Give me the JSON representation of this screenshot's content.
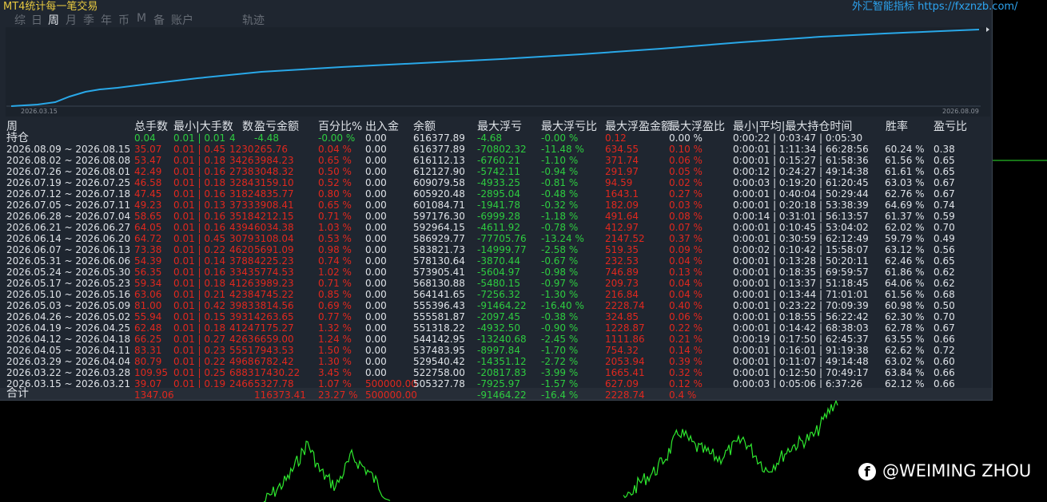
{
  "app_title": "MT4统计每一笔交易",
  "header_link": {
    "prefix": "外汇智能指标",
    "url": "https://fxznzb.com/"
  },
  "tabs": [
    {
      "label": "综"
    },
    {
      "label": "日"
    },
    {
      "label": "周",
      "active": true
    },
    {
      "label": "月"
    },
    {
      "label": "季"
    },
    {
      "label": "年"
    },
    {
      "label": "币"
    },
    {
      "label": "M"
    },
    {
      "label": "备"
    },
    {
      "label": "账户"
    },
    {
      "label": "轨迹"
    }
  ],
  "equity_chart": {
    "start_date": "2026.03.15",
    "end_date": "2026.08.09",
    "line_color": "#29a8e8"
  },
  "columns": [
    "周",
    "总手数",
    "最小|大手数",
    "数",
    "盈亏金额",
    "百分比%",
    "出入金",
    "余额",
    "最大浮亏",
    "最大浮亏比",
    "最大浮盈金额",
    "最大浮盈比",
    "最小|平均|最大持仓时间",
    "胜率",
    "盈亏比"
  ],
  "holding": {
    "label": "持仓",
    "lots": "0.04",
    "minmax": "0.01 | 0.01",
    "count": "4",
    "pnl": "-4.48",
    "pct": "-0.00 %",
    "deposit": "0.00",
    "balance": "616377.89",
    "max_dd": "-4.68",
    "max_dd_pct": "-0.00 %",
    "max_fp": "0.12",
    "max_fp_pct": "0.00 %",
    "hold_time": "0:00:22 | 0:03:47 | 0:05:30"
  },
  "rows": [
    {
      "period": "2026.08.09 ~ 2026.08.15",
      "lots": "35.07",
      "minmax": "0.01 | 0.45",
      "count": "1230",
      "pnl": "265.76",
      "pct": "0.04 %",
      "deposit": "0.00",
      "balance": "616377.89",
      "max_dd": "-70802.32",
      "max_dd_pct": "-11.48 %",
      "max_fp": "634.55",
      "max_fp_pct": "0.10 %",
      "hold_time": "0:00:01 | 1:11:34 | 66:28:56",
      "win_rate": "60.24 %",
      "pl_ratio": "0.38"
    },
    {
      "period": "2026.08.02 ~ 2026.08.08",
      "lots": "53.47",
      "minmax": "0.01 | 0.18",
      "count": "3426",
      "pnl": "3984.23",
      "pct": "0.65 %",
      "deposit": "0.00",
      "balance": "616112.13",
      "max_dd": "-6760.21",
      "max_dd_pct": "-1.10 %",
      "max_fp": "371.74",
      "max_fp_pct": "0.06 %",
      "hold_time": "0:00:01 | 0:15:27 | 61:58:36",
      "win_rate": "61.56 %",
      "pl_ratio": "0.65"
    },
    {
      "period": "2026.07.26 ~ 2026.08.01",
      "lots": "42.49",
      "minmax": "0.01 | 0.16",
      "count": "2738",
      "pnl": "3048.32",
      "pct": "0.50 %",
      "deposit": "0.00",
      "balance": "612127.90",
      "max_dd": "-5742.11",
      "max_dd_pct": "-0.94 %",
      "max_fp": "291.97",
      "max_fp_pct": "0.05 %",
      "hold_time": "0:00:12 | 0:24:27 | 49:14:38",
      "win_rate": "61.61 %",
      "pl_ratio": "0.65"
    },
    {
      "period": "2026.07.19 ~ 2026.07.25",
      "lots": "46.58",
      "minmax": "0.01 | 0.18",
      "count": "3284",
      "pnl": "3159.10",
      "pct": "0.52 %",
      "deposit": "0.00",
      "balance": "609079.58",
      "max_dd": "-4933.25",
      "max_dd_pct": "-0.81 %",
      "max_fp": "94.59",
      "max_fp_pct": "0.02 %",
      "hold_time": "0:00:03 | 0:19:20 | 61:20:45",
      "win_rate": "63.03 %",
      "pl_ratio": "0.67"
    },
    {
      "period": "2026.07.12 ~ 2026.07.18",
      "lots": "47.45",
      "minmax": "0.01 | 0.16",
      "count": "3182",
      "pnl": "4835.77",
      "pct": "0.80 %",
      "deposit": "0.00",
      "balance": "605920.48",
      "max_dd": "-2895.04",
      "max_dd_pct": "-0.48 %",
      "max_fp": "1643.1",
      "max_fp_pct": "0.27 %",
      "hold_time": "0:00:01 | 0:40:04 | 50:29:44",
      "win_rate": "62.76 %",
      "pl_ratio": "0.67"
    },
    {
      "period": "2026.07.05 ~ 2026.07.11",
      "lots": "49.23",
      "minmax": "0.01 | 0.13",
      "count": "3733",
      "pnl": "3908.41",
      "pct": "0.65 %",
      "deposit": "0.00",
      "balance": "601084.71",
      "max_dd": "-1941.78",
      "max_dd_pct": "-0.32 %",
      "max_fp": "182.09",
      "max_fp_pct": "0.03 %",
      "hold_time": "0:00:01 | 0:20:18 | 53:38:39",
      "win_rate": "64.69 %",
      "pl_ratio": "0.74"
    },
    {
      "period": "2026.06.28 ~ 2026.07.04",
      "lots": "58.65",
      "minmax": "0.01 | 0.16",
      "count": "3518",
      "pnl": "4212.15",
      "pct": "0.71 %",
      "deposit": "0.00",
      "balance": "597176.30",
      "max_dd": "-6999.28",
      "max_dd_pct": "-1.18 %",
      "max_fp": "491.64",
      "max_fp_pct": "0.08 %",
      "hold_time": "0:00:14 | 0:31:01 | 56:13:57",
      "win_rate": "61.37 %",
      "pl_ratio": "0.59"
    },
    {
      "period": "2026.06.21 ~ 2026.06.27",
      "lots": "64.05",
      "minmax": "0.01 | 0.16",
      "count": "4394",
      "pnl": "6034.38",
      "pct": "1.03 %",
      "deposit": "0.00",
      "balance": "592964.15",
      "max_dd": "-4611.92",
      "max_dd_pct": "-0.78 %",
      "max_fp": "412.97",
      "max_fp_pct": "0.07 %",
      "hold_time": "0:00:01 | 0:10:45 | 53:04:02",
      "win_rate": "62.02 %",
      "pl_ratio": "0.70"
    },
    {
      "period": "2026.06.14 ~ 2026.06.20",
      "lots": "64.72",
      "minmax": "0.01 | 0.45",
      "count": "3079",
      "pnl": "3108.04",
      "pct": "0.53 %",
      "deposit": "0.00",
      "balance": "586929.77",
      "max_dd": "-77705.76",
      "max_dd_pct": "-13.24 %",
      "max_fp": "2147.52",
      "max_fp_pct": "0.37 %",
      "hold_time": "0:00:01 | 0:30:59 | 62:12:49",
      "win_rate": "59.79 %",
      "pl_ratio": "0.49"
    },
    {
      "period": "2026.06.07 ~ 2026.06.13",
      "lots": "73.38",
      "minmax": "0.01 | 0.22",
      "count": "4620",
      "pnl": "5691.09",
      "pct": "0.98 %",
      "deposit": "0.00",
      "balance": "583821.73",
      "max_dd": "-14999.77",
      "max_dd_pct": "-2.58 %",
      "max_fp": "519.35",
      "max_fp_pct": "0.09 %",
      "hold_time": "0:00:02 | 0:10:42 | 15:58:07",
      "win_rate": "63.12 %",
      "pl_ratio": "0.56"
    },
    {
      "period": "2026.05.31 ~ 2026.06.06",
      "lots": "54.39",
      "minmax": "0.01 | 0.14",
      "count": "3788",
      "pnl": "4225.23",
      "pct": "0.74 %",
      "deposit": "0.00",
      "balance": "578130.64",
      "max_dd": "-3870.44",
      "max_dd_pct": "-0.67 %",
      "max_fp": "232.53",
      "max_fp_pct": "0.04 %",
      "hold_time": "0:00:01 | 0:13:28 | 50:20:11",
      "win_rate": "62.46 %",
      "pl_ratio": "0.65"
    },
    {
      "period": "2026.05.24 ~ 2026.05.30",
      "lots": "56.35",
      "minmax": "0.01 | 0.16",
      "count": "3343",
      "pnl": "5774.53",
      "pct": "1.02 %",
      "deposit": "0.00",
      "balance": "573905.41",
      "max_dd": "-5604.97",
      "max_dd_pct": "-0.98 %",
      "max_fp": "746.89",
      "max_fp_pct": "0.13 %",
      "hold_time": "0:00:01 | 0:18:35 | 69:59:57",
      "win_rate": "61.86 %",
      "pl_ratio": "0.62"
    },
    {
      "period": "2026.05.17 ~ 2026.05.23",
      "lots": "59.34",
      "minmax": "0.01 | 0.18",
      "count": "4126",
      "pnl": "3989.23",
      "pct": "0.71 %",
      "deposit": "0.00",
      "balance": "568130.88",
      "max_dd": "-5480.15",
      "max_dd_pct": "-0.97 %",
      "max_fp": "209.73",
      "max_fp_pct": "0.04 %",
      "hold_time": "0:00:01 | 0:13:37 | 51:18:45",
      "win_rate": "64.06 %",
      "pl_ratio": "0.62"
    },
    {
      "period": "2026.05.10 ~ 2026.05.16",
      "lots": "63.06",
      "minmax": "0.01 | 0.21",
      "count": "4238",
      "pnl": "4745.22",
      "pct": "0.85 %",
      "deposit": "0.00",
      "balance": "564141.65",
      "max_dd": "-7256.32",
      "max_dd_pct": "-1.30 %",
      "max_fp": "216.84",
      "max_fp_pct": "0.04 %",
      "hold_time": "0:00:01 | 0:13:44 | 71:01:01",
      "win_rate": "61.56 %",
      "pl_ratio": "0.68"
    },
    {
      "period": "2026.05.03 ~ 2026.05.09",
      "lots": "81.00",
      "minmax": "0.01 | 0.42",
      "count": "3983",
      "pnl": "3814.56",
      "pct": "0.69 %",
      "deposit": "0.00",
      "balance": "555396.43",
      "max_dd": "-91464.22",
      "max_dd_pct": "-16.40 %",
      "max_fp": "2228.74",
      "max_fp_pct": "0.40 %",
      "hold_time": "0:00:01 | 0:23:22 | 70:09:39",
      "win_rate": "60.98 %",
      "pl_ratio": "0.50"
    },
    {
      "period": "2026.04.26 ~ 2026.05.02",
      "lots": "55.94",
      "minmax": "0.01 | 0.15",
      "count": "3931",
      "pnl": "4263.65",
      "pct": "0.77 %",
      "deposit": "0.00",
      "balance": "555581.87",
      "max_dd": "-2097.45",
      "max_dd_pct": "-0.38 %",
      "max_fp": "324.85",
      "max_fp_pct": "0.06 %",
      "hold_time": "0:00:01 | 0:18:55 | 56:22:42",
      "win_rate": "62.30 %",
      "pl_ratio": "0.70"
    },
    {
      "period": "2026.04.19 ~ 2026.04.25",
      "lots": "62.48",
      "minmax": "0.01 | 0.18",
      "count": "4124",
      "pnl": "7175.27",
      "pct": "1.32 %",
      "deposit": "0.00",
      "balance": "551318.22",
      "max_dd": "-4932.50",
      "max_dd_pct": "-0.90 %",
      "max_fp": "1228.87",
      "max_fp_pct": "0.22 %",
      "hold_time": "0:00:01 | 0:14:42 | 68:38:03",
      "win_rate": "62.78 %",
      "pl_ratio": "0.67"
    },
    {
      "period": "2026.04.12 ~ 2026.04.18",
      "lots": "66.25",
      "minmax": "0.01 | 0.27",
      "count": "4263",
      "pnl": "6659.00",
      "pct": "1.24 %",
      "deposit": "0.00",
      "balance": "544142.95",
      "max_dd": "-13240.68",
      "max_dd_pct": "-2.45 %",
      "max_fp": "1111.86",
      "max_fp_pct": "0.21 %",
      "hold_time": "0:00:19 | 0:17:50 | 62:45:37",
      "win_rate": "63.55 %",
      "pl_ratio": "0.66"
    },
    {
      "period": "2026.04.05 ~ 2026.04.11",
      "lots": "83.31",
      "minmax": "0.01 | 0.23",
      "count": "5551",
      "pnl": "7943.53",
      "pct": "1.50 %",
      "deposit": "0.00",
      "balance": "537483.95",
      "max_dd": "-8997.84",
      "max_dd_pct": "-1.70 %",
      "max_fp": "754.32",
      "max_fp_pct": "0.14 %",
      "hold_time": "0:00:01 | 0:16:01 | 91:19:38",
      "win_rate": "62.62 %",
      "pl_ratio": "0.72"
    },
    {
      "period": "2026.03.29 ~ 2026.04.04",
      "lots": "80.79",
      "minmax": "0.01 | 0.22",
      "count": "4968",
      "pnl": "6782.42",
      "pct": "1.30 %",
      "deposit": "0.00",
      "balance": "529540.42",
      "max_dd": "-14351.12",
      "max_dd_pct": "-2.72 %",
      "max_fp": "2053.94",
      "max_fp_pct": "0.39 %",
      "hold_time": "0:00:01 | 0:11:07 | 49:14:48",
      "win_rate": "63.02 %",
      "pl_ratio": "0.60"
    },
    {
      "period": "2026.03.22 ~ 2026.03.28",
      "lots": "109.95",
      "minmax": "0.01 | 0.25",
      "count": "6883",
      "pnl": "17430.22",
      "pct": "3.45 %",
      "deposit": "0.00",
      "balance": "522758.00",
      "max_dd": "-20817.83",
      "max_dd_pct": "-3.99 %",
      "max_fp": "1665.41",
      "max_fp_pct": "0.32 %",
      "hold_time": "0:00:01 | 0:12:50 | 70:49:17",
      "win_rate": "63.84 %",
      "pl_ratio": "0.66"
    },
    {
      "period": "2026.03.15 ~ 2026.03.21",
      "lots": "39.07",
      "minmax": "0.01 | 0.19",
      "count": "2466",
      "pnl": "5327.78",
      "pct": "1.07 %",
      "deposit": "500000.00",
      "balance": "505327.78",
      "max_dd": "-7925.97",
      "max_dd_pct": "-1.57 %",
      "max_fp": "627.09",
      "max_fp_pct": "0.12 %",
      "hold_time": "0:00:03 | 0:05:06 | 6:37:26",
      "win_rate": "62.12 %",
      "pl_ratio": "0.66"
    }
  ],
  "total": {
    "label": "合计",
    "lots": "1347.06",
    "pnl": "116373.41",
    "pct": "23.27 %",
    "deposit": "500000.00",
    "max_dd": "-91464.22",
    "max_dd_pct": "-16.4 %",
    "max_fp": "2228.74",
    "max_fp_pct": "0.4 %"
  },
  "watermark": {
    "text": "@WEIMING ZHOU",
    "icon": "facebook-icon"
  },
  "colors": {
    "panel_bg": "#1f2630",
    "positive": "#2ecc40",
    "negative": "#e0281e",
    "equity_line": "#29a8e8",
    "price_line": "#2ee82e"
  }
}
